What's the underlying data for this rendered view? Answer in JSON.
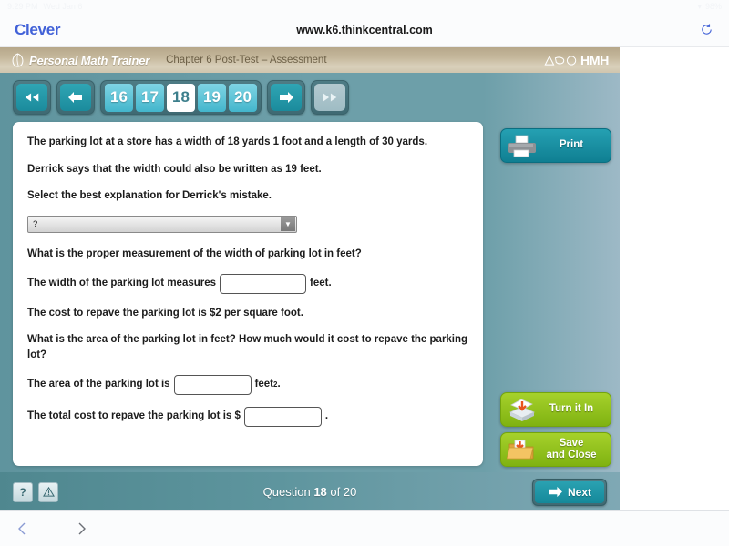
{
  "status_bar": {
    "time": "9:29 PM",
    "date": "Wed Jan 6",
    "battery": "98%"
  },
  "browser": {
    "logo_text": "Clever",
    "url": "www.k6.thinkcentral.com",
    "reload_icon": "reload-icon",
    "back_icon": "chevron-left-icon",
    "forward_icon": "chevron-right-icon"
  },
  "app_header": {
    "logo_icon": "pmt-shell-icon",
    "product_title": "Personal Math Trainer",
    "chapter_title": "Chapter 6 Post-Test – Assessment",
    "brand_text": "HMH",
    "brand_icon": "hmh-mark-icon",
    "bg_color": "#c5b89c"
  },
  "navigation": {
    "first_label": "first-page",
    "prev_label": "previous-page",
    "next_label": "next-page",
    "last_label": "last-page",
    "pages": [
      {
        "number": "16",
        "current": false
      },
      {
        "number": "17",
        "current": false
      },
      {
        "number": "18",
        "current": true
      },
      {
        "number": "19",
        "current": false
      },
      {
        "number": "20",
        "current": false
      }
    ],
    "accent_color": "#43b6cc"
  },
  "question": {
    "line1": "The parking lot at a store has a width of 18 yards 1 foot and a length of 30 yards.",
    "line2": "Derrick says that the width could also be written as 19 feet.",
    "line3": "Select the best explanation for Derrick's mistake.",
    "dropdown_value": "?",
    "line4": "What is the proper measurement of the width of parking lot in feet?",
    "line5_before": "The width of the parking lot measures",
    "line5_after": "feet.",
    "width_input_value": "",
    "line6": "The cost to repave the parking lot is $2 per square foot.",
    "line7": "What is the area of the parking lot in feet? How much would it cost to repave the parking lot?",
    "line8_before": "The area of the parking lot is",
    "line8_after": "feet",
    "line8_sup": "2",
    "line8_end": ".",
    "area_input_value": "",
    "line9_before": "The total cost to repave the parking lot is $",
    "line9_after": ".",
    "cost_input_value": ""
  },
  "sidebar": {
    "print_label": "Print",
    "print_icon": "printer-icon",
    "turn_in_label": "Turn it In",
    "turn_in_icon": "inbox-tray-icon",
    "save_close_line1": "Save",
    "save_close_line2": "and Close",
    "save_close_icon": "folder-download-icon",
    "print_color": "#0f7f92",
    "green_color": "#8fc21a"
  },
  "footer": {
    "help_icon": "question-mark-icon",
    "alert_icon": "warning-triangle-icon",
    "counter_prefix": "Question",
    "counter_current": "18",
    "counter_middle": "of",
    "counter_total": "20",
    "counter_full": "Question 18 of 20",
    "next_label": "Next",
    "next_icon": "arrow-right-icon"
  }
}
